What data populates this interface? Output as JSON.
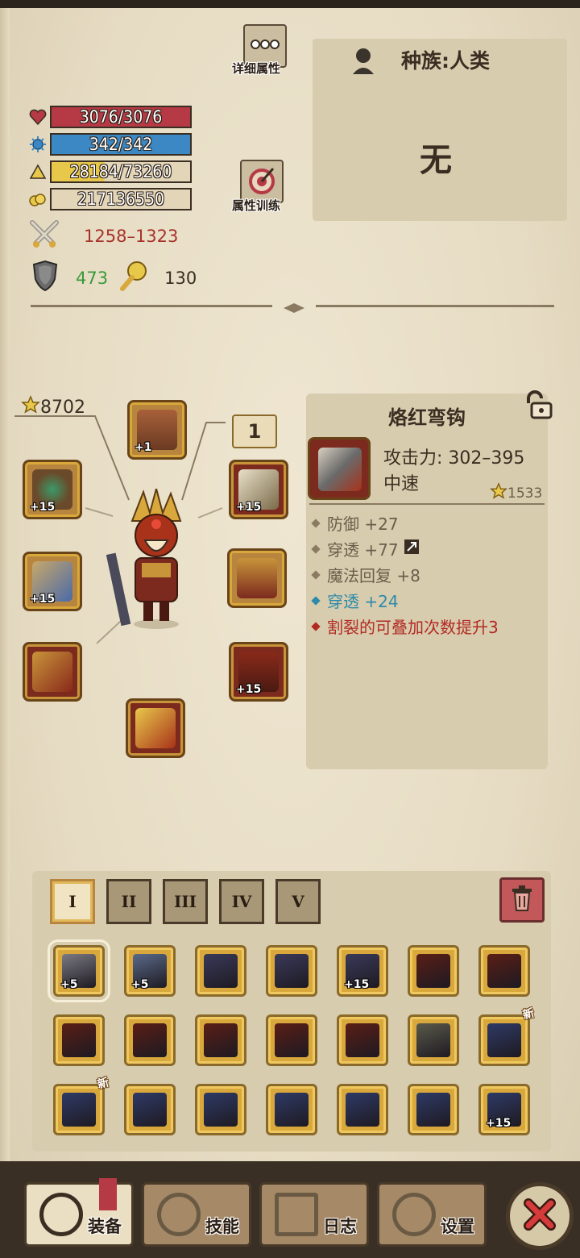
{
  "header": {
    "detail_attr_label": "详细属性",
    "train_label": "属性训练"
  },
  "stats": {
    "hp": "3076/3076",
    "mp": "342/342",
    "xp": "28184/73260",
    "xp_fraction": 0.385,
    "gold": "217136550",
    "attack": "1258–1323",
    "defense": "473",
    "speed": "130"
  },
  "race": {
    "label": "种族:人类",
    "value": "无"
  },
  "equipment": {
    "rating": "8702",
    "level_badge": "1",
    "slots": [
      {
        "name": "helmet",
        "plus": "+1"
      },
      {
        "name": "amulet",
        "plus": "+15"
      },
      {
        "name": "ring",
        "plus": "+15"
      },
      {
        "name": "weapon-staff",
        "plus": "+15"
      },
      {
        "name": "chest",
        "plus": ""
      },
      {
        "name": "gloves",
        "plus": ""
      },
      {
        "name": "pants",
        "plus": "+15"
      },
      {
        "name": "boots",
        "plus": ""
      }
    ]
  },
  "item_detail": {
    "name": "烙红弯钩",
    "attack": "攻击力: 302–395",
    "speed": "中速",
    "rating": "1533",
    "lines": [
      {
        "text": "防御 +27",
        "color": "#6b5d4a"
      },
      {
        "text": "穿透 +77",
        "color": "#6b5d4a"
      },
      {
        "text": "魔法回复 +8",
        "color": "#6b5d4a"
      },
      {
        "text": "穿透 +24",
        "color": "#2e8aa8"
      },
      {
        "text": "割裂的可叠加次数提升3",
        "color": "#b22a22"
      }
    ]
  },
  "inventory": {
    "tabs": [
      "I",
      "II",
      "III",
      "IV",
      "V"
    ],
    "new_label": "新",
    "items": [
      {
        "plus": "+5",
        "new": false
      },
      {
        "plus": "+5",
        "new": false
      },
      {
        "plus": "",
        "new": false
      },
      {
        "plus": "",
        "new": false
      },
      {
        "plus": "+15",
        "new": false
      },
      {
        "plus": "",
        "new": false
      },
      {
        "plus": "",
        "new": false
      },
      {
        "plus": "",
        "new": false
      },
      {
        "plus": "",
        "new": false
      },
      {
        "plus": "",
        "new": false
      },
      {
        "plus": "",
        "new": false
      },
      {
        "plus": "",
        "new": false
      },
      {
        "plus": "",
        "new": false
      },
      {
        "plus": "",
        "new": true
      },
      {
        "plus": "",
        "new": true
      },
      {
        "plus": "",
        "new": false
      },
      {
        "plus": "",
        "new": false
      },
      {
        "plus": "",
        "new": false
      },
      {
        "plus": "",
        "new": false
      },
      {
        "plus": "",
        "new": false
      },
      {
        "plus": "+15",
        "new": false
      }
    ]
  },
  "nav": {
    "equip": "装备",
    "skills": "技能",
    "log": "日志",
    "settings": "设置"
  },
  "colors": {
    "hp": "#b53a45",
    "mp": "#3b88c4",
    "attack_text": "#a8322a",
    "defense_text": "#3a9a3a",
    "penetration": "#2e8aa8",
    "special": "#b22a22"
  }
}
